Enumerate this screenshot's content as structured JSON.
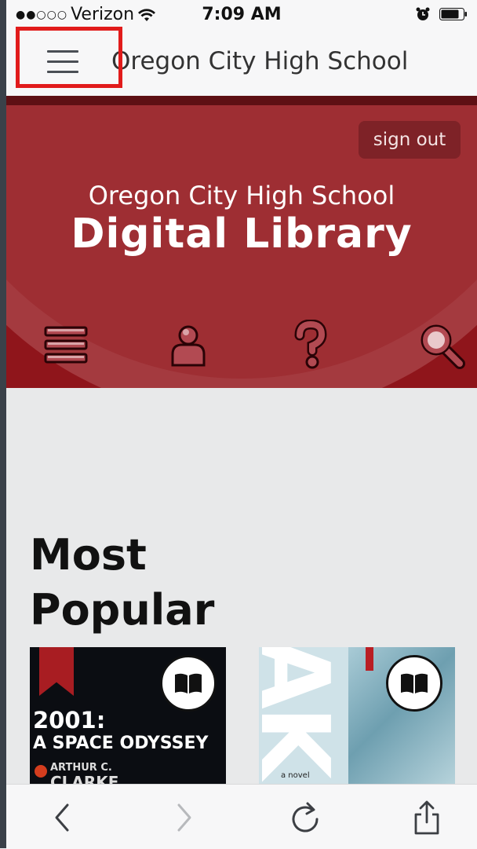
{
  "status_bar": {
    "signal": "●●○○○",
    "carrier": "Verizon",
    "time": "7:09 AM"
  },
  "browser": {
    "page_title": "Oregon City High School"
  },
  "banner": {
    "sign_out": "sign out",
    "school_name": "Oregon City High School",
    "library_title": "Digital Library",
    "nav_icons": [
      "menu-icon",
      "account-icon",
      "help-icon",
      "search-icon"
    ]
  },
  "content": {
    "section_title": "Most Popular",
    "books": [
      {
        "title_line1": "2001:",
        "title_line2": "A SPACE ODYSSEY",
        "author_first": "ARTHUR C.",
        "author_last": "CLARKE",
        "bookmarked": true
      },
      {
        "cover_text": "AK",
        "small_text": "a novel",
        "bookmarked": false
      }
    ]
  },
  "toolbar": {
    "icons": [
      "back-icon",
      "forward-icon",
      "reload-icon",
      "share-icon"
    ]
  },
  "colors": {
    "banner": "#8f151b",
    "sign_out_bg": "#7e2227",
    "highlight": "#e11b1b"
  }
}
